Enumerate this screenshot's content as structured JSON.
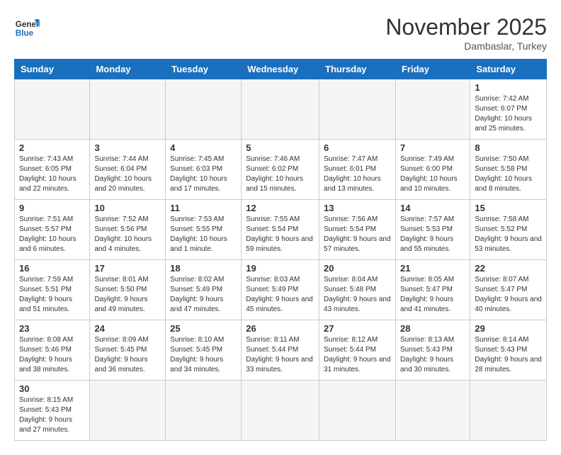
{
  "header": {
    "logo_general": "General",
    "logo_blue": "Blue",
    "title": "November 2025",
    "location": "Dambaslar, Turkey"
  },
  "weekdays": [
    "Sunday",
    "Monday",
    "Tuesday",
    "Wednesday",
    "Thursday",
    "Friday",
    "Saturday"
  ],
  "weeks": [
    [
      {
        "day": "",
        "info": ""
      },
      {
        "day": "",
        "info": ""
      },
      {
        "day": "",
        "info": ""
      },
      {
        "day": "",
        "info": ""
      },
      {
        "day": "",
        "info": ""
      },
      {
        "day": "",
        "info": ""
      },
      {
        "day": "1",
        "info": "Sunrise: 7:42 AM\nSunset: 6:07 PM\nDaylight: 10 hours\nand 25 minutes."
      }
    ],
    [
      {
        "day": "2",
        "info": "Sunrise: 7:43 AM\nSunset: 6:05 PM\nDaylight: 10 hours\nand 22 minutes."
      },
      {
        "day": "3",
        "info": "Sunrise: 7:44 AM\nSunset: 6:04 PM\nDaylight: 10 hours\nand 20 minutes."
      },
      {
        "day": "4",
        "info": "Sunrise: 7:45 AM\nSunset: 6:03 PM\nDaylight: 10 hours\nand 17 minutes."
      },
      {
        "day": "5",
        "info": "Sunrise: 7:46 AM\nSunset: 6:02 PM\nDaylight: 10 hours\nand 15 minutes."
      },
      {
        "day": "6",
        "info": "Sunrise: 7:47 AM\nSunset: 6:01 PM\nDaylight: 10 hours\nand 13 minutes."
      },
      {
        "day": "7",
        "info": "Sunrise: 7:49 AM\nSunset: 6:00 PM\nDaylight: 10 hours\nand 10 minutes."
      },
      {
        "day": "8",
        "info": "Sunrise: 7:50 AM\nSunset: 5:58 PM\nDaylight: 10 hours\nand 8 minutes."
      }
    ],
    [
      {
        "day": "9",
        "info": "Sunrise: 7:51 AM\nSunset: 5:57 PM\nDaylight: 10 hours\nand 6 minutes."
      },
      {
        "day": "10",
        "info": "Sunrise: 7:52 AM\nSunset: 5:56 PM\nDaylight: 10 hours\nand 4 minutes."
      },
      {
        "day": "11",
        "info": "Sunrise: 7:53 AM\nSunset: 5:55 PM\nDaylight: 10 hours\nand 1 minute."
      },
      {
        "day": "12",
        "info": "Sunrise: 7:55 AM\nSunset: 5:54 PM\nDaylight: 9 hours\nand 59 minutes."
      },
      {
        "day": "13",
        "info": "Sunrise: 7:56 AM\nSunset: 5:54 PM\nDaylight: 9 hours\nand 57 minutes."
      },
      {
        "day": "14",
        "info": "Sunrise: 7:57 AM\nSunset: 5:53 PM\nDaylight: 9 hours\nand 55 minutes."
      },
      {
        "day": "15",
        "info": "Sunrise: 7:58 AM\nSunset: 5:52 PM\nDaylight: 9 hours\nand 53 minutes."
      }
    ],
    [
      {
        "day": "16",
        "info": "Sunrise: 7:59 AM\nSunset: 5:51 PM\nDaylight: 9 hours\nand 51 minutes."
      },
      {
        "day": "17",
        "info": "Sunrise: 8:01 AM\nSunset: 5:50 PM\nDaylight: 9 hours\nand 49 minutes."
      },
      {
        "day": "18",
        "info": "Sunrise: 8:02 AM\nSunset: 5:49 PM\nDaylight: 9 hours\nand 47 minutes."
      },
      {
        "day": "19",
        "info": "Sunrise: 8:03 AM\nSunset: 5:49 PM\nDaylight: 9 hours\nand 45 minutes."
      },
      {
        "day": "20",
        "info": "Sunrise: 8:04 AM\nSunset: 5:48 PM\nDaylight: 9 hours\nand 43 minutes."
      },
      {
        "day": "21",
        "info": "Sunrise: 8:05 AM\nSunset: 5:47 PM\nDaylight: 9 hours\nand 41 minutes."
      },
      {
        "day": "22",
        "info": "Sunrise: 8:07 AM\nSunset: 5:47 PM\nDaylight: 9 hours\nand 40 minutes."
      }
    ],
    [
      {
        "day": "23",
        "info": "Sunrise: 8:08 AM\nSunset: 5:46 PM\nDaylight: 9 hours\nand 38 minutes."
      },
      {
        "day": "24",
        "info": "Sunrise: 8:09 AM\nSunset: 5:45 PM\nDaylight: 9 hours\nand 36 minutes."
      },
      {
        "day": "25",
        "info": "Sunrise: 8:10 AM\nSunset: 5:45 PM\nDaylight: 9 hours\nand 34 minutes."
      },
      {
        "day": "26",
        "info": "Sunrise: 8:11 AM\nSunset: 5:44 PM\nDaylight: 9 hours\nand 33 minutes."
      },
      {
        "day": "27",
        "info": "Sunrise: 8:12 AM\nSunset: 5:44 PM\nDaylight: 9 hours\nand 31 minutes."
      },
      {
        "day": "28",
        "info": "Sunrise: 8:13 AM\nSunset: 5:43 PM\nDaylight: 9 hours\nand 30 minutes."
      },
      {
        "day": "29",
        "info": "Sunrise: 8:14 AM\nSunset: 5:43 PM\nDaylight: 9 hours\nand 28 minutes."
      }
    ],
    [
      {
        "day": "30",
        "info": "Sunrise: 8:15 AM\nSunset: 5:43 PM\nDaylight: 9 hours\nand 27 minutes."
      },
      {
        "day": "",
        "info": ""
      },
      {
        "day": "",
        "info": ""
      },
      {
        "day": "",
        "info": ""
      },
      {
        "day": "",
        "info": ""
      },
      {
        "day": "",
        "info": ""
      },
      {
        "day": "",
        "info": ""
      }
    ]
  ]
}
